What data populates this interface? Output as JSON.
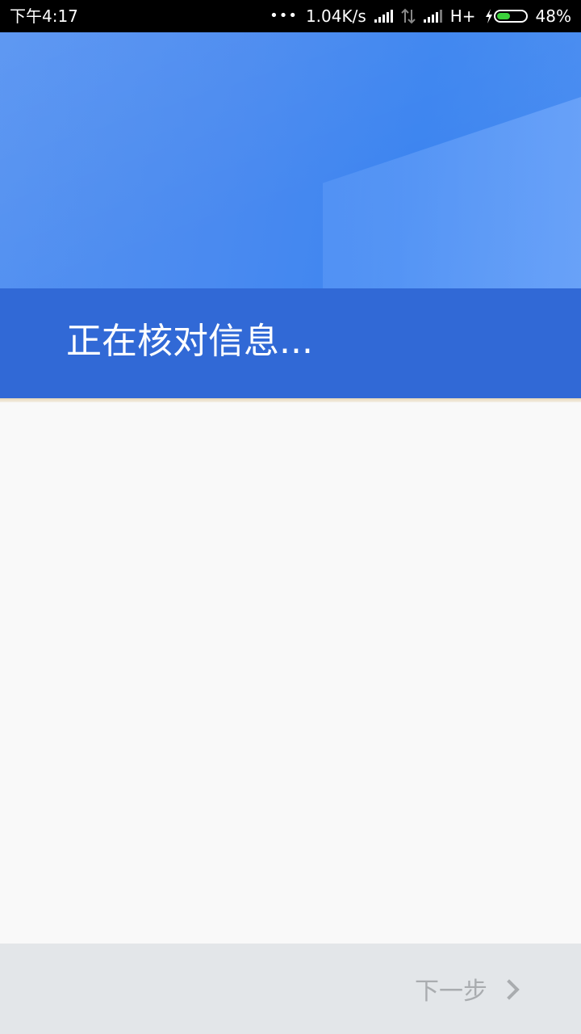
{
  "status_bar": {
    "time": "下午4:17",
    "more_indicator": "•••",
    "network_speed": "1.04K/s",
    "network_type": "H+",
    "battery_percent": "48%",
    "battery_level": 0.48,
    "battery_color": "#3bd13b"
  },
  "header": {
    "title": "正在核对信息..."
  },
  "footer": {
    "next_label": "下一步"
  },
  "colors": {
    "banner_blue": "#3d85f0",
    "title_band": "#3169d6",
    "footer_bg": "#e3e6e9",
    "disabled_text": "#a9acaf"
  }
}
